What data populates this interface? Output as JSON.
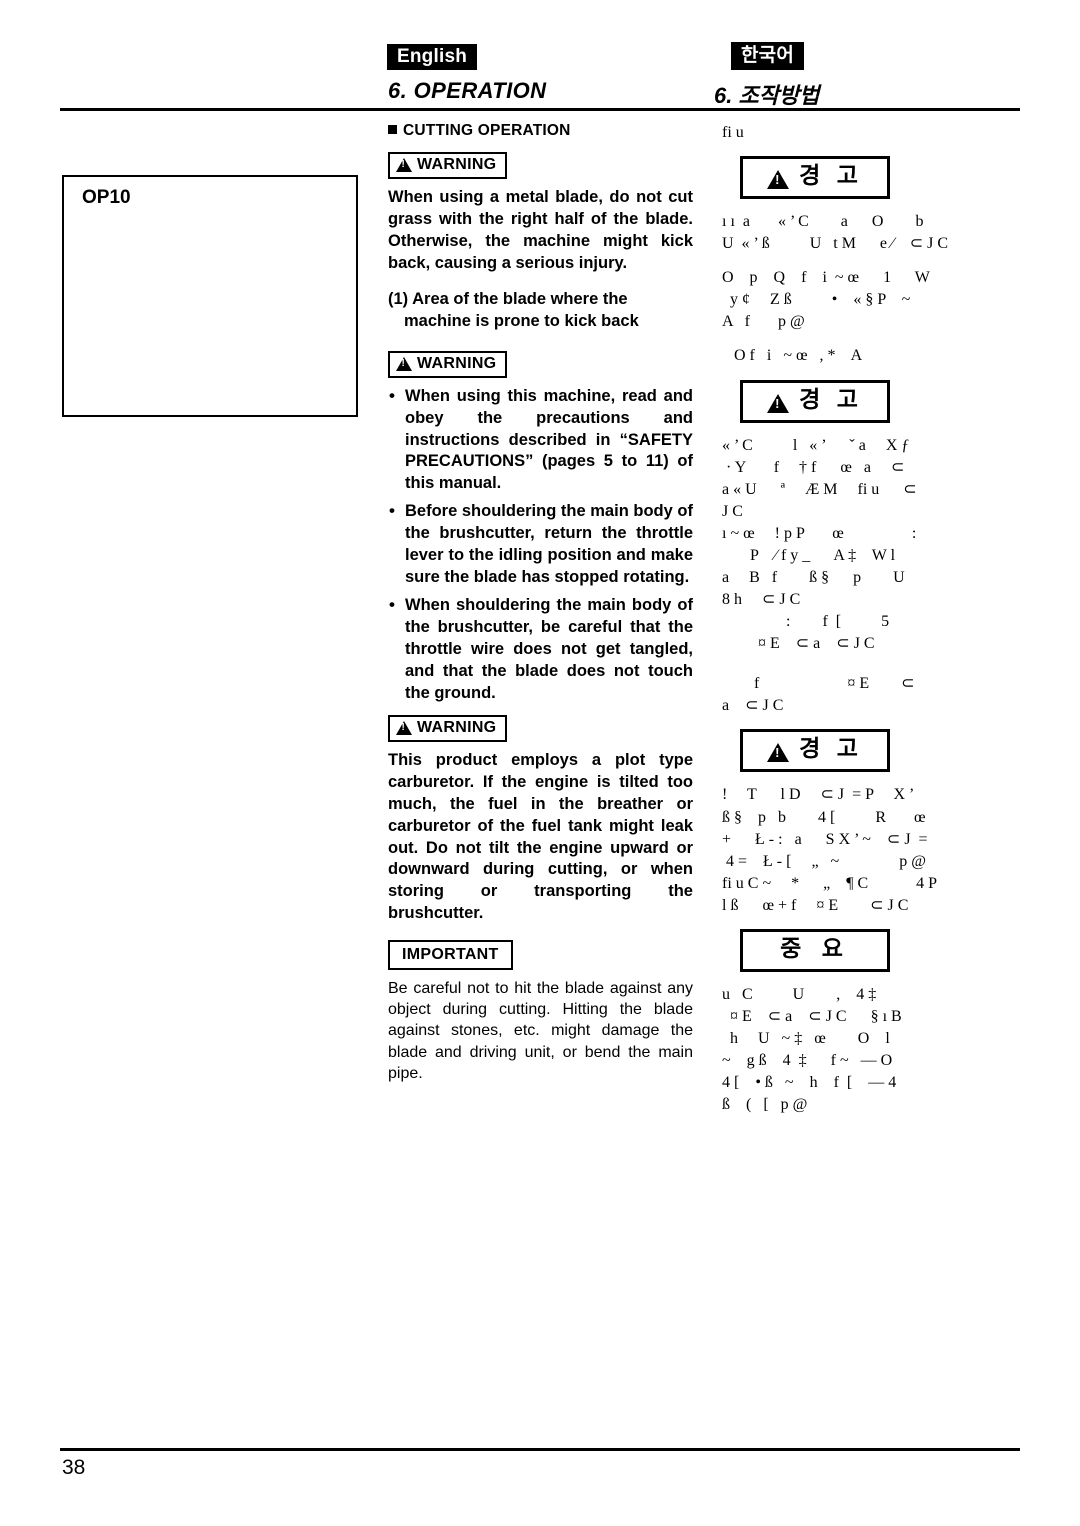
{
  "header": {
    "lang_left": "English",
    "lang_right": "한국어",
    "section_left": "6. OPERATION",
    "section_right": "6. 조작방법"
  },
  "figure": {
    "label": "OP10"
  },
  "footer": {
    "page_number": "38"
  },
  "english": {
    "bullet_heading": "CUTTING OPERATION",
    "warning_label": "WARNING",
    "important_label": "IMPORTANT",
    "warning1_text": "When using a metal blade, do not cut grass with the right half of the blade. Otherwise, the machine might kick back, causing a serious injury.",
    "callout1_line1": "(1) Area of the blade where the",
    "callout1_line2": "machine is prone to kick back",
    "warning2_item1": "When using this machine, read and obey the precautions and instructions described in “SAFETY PRECAUTIONS” (pages 5 to 11) of this manual.",
    "warning2_item2": "Before shouldering the main body of the brushcutter, return the throttle lever to the idling position and make sure the blade has stopped rotating.",
    "warning2_item3": "When shouldering the main body of the brushcutter, be careful that the throttle wire does not get tangled, and that the blade does not touch the ground.",
    "warning3_text": "This product employs a plot type carburetor. If the engine is tilted too much, the fuel in the breather or carburetor of the fuel tank might leak out. Do not tilt the engine upward or downward during cutting, or when storing or transporting the brushcutter.",
    "important_text": "Be careful not to hit the blade against any object during cutting. Hitting the blade against stones, etc. might damage the blade and driving unit, or bend the main pipe."
  },
  "korean": {
    "top_line": "fi u",
    "warning_label": "경 고",
    "important_label": "중 요",
    "block1": [
      "ı ı  a       « ’ C        a      O        b",
      "U  « ’ ß          U   t M      e ∕    ⊂ J C"
    ],
    "block2": [
      "O    p    Q    f    i  ~ œ      1      W",
      "  y ¢     Z ß          •    « § P    ~",
      "A   f       p @"
    ],
    "block3": [
      "   O f   i   ~ œ   , *    A"
    ],
    "block4": [
      "« ’ C          l   « ’      ˇ a     X ƒ",
      " · Y       f     † f      œ   a     ⊂",
      "a « U      ª     Æ M     fi u      ⊂",
      "J C",
      "ı ~ œ     ! p P       œ                 :",
      "       P    ∕ f y _      A ‡    W l",
      "a     B   f        ß §      p        U",
      "8 h     ⊂ J C",
      "                :        f  [          5",
      "         ¤ E    ⊂ a    ⊂ J C"
    ],
    "block5": [
      "        f                      ¤ E        ⊂",
      "a    ⊂ J C"
    ],
    "block6": [
      "!     T      l D     ⊂ J  = P     X ’",
      "ß §    p   b        4 [          R       œ",
      "+      Ł - :   a      S X ’ ~    ⊂ J  =",
      " 4 =    Ł - [     „   ~               p @",
      "fi u C ~     *      „    ¶ C            4 P",
      "l ß      œ + f     ¤ E        ⊂ J C"
    ],
    "block7": [
      "u   C          U        ,    4 ‡",
      "  ¤ E    ⊂ a    ⊂ J C      § ı B",
      "  h     U   ~ ‡   œ        O    l",
      "~    g ß    4  ‡      f ~   — O",
      "4 [    • ß   ~    h    f  [    — 4",
      "ß    (   [   p @"
    ]
  }
}
